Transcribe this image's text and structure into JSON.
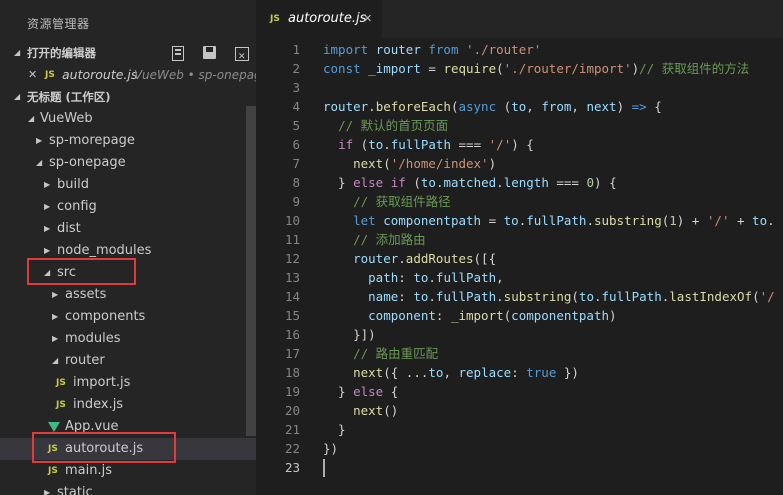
{
  "explorer": {
    "title": "资源管理器",
    "open_editors": {
      "label": "打开的编辑器",
      "file": {
        "badge": "JS",
        "name": "autoroute.js",
        "desc": "VueWeb • sp-onepag..."
      }
    },
    "workspace": {
      "label": "无标题 (工作区)"
    },
    "tree": [
      {
        "label": "VueWeb",
        "depth": 1,
        "twist": "open"
      },
      {
        "label": "sp-morepage",
        "depth": 2,
        "twist": "closed"
      },
      {
        "label": "sp-onepage",
        "depth": 2,
        "twist": "open"
      },
      {
        "label": "build",
        "depth": 3,
        "twist": "closed"
      },
      {
        "label": "config",
        "depth": 3,
        "twist": "closed"
      },
      {
        "label": "dist",
        "depth": 3,
        "twist": "closed"
      },
      {
        "label": "node_modules",
        "depth": 3,
        "twist": "closed"
      },
      {
        "label": "src",
        "depth": 3,
        "twist": "open"
      },
      {
        "label": "assets",
        "depth": 4,
        "twist": "closed"
      },
      {
        "label": "components",
        "depth": 4,
        "twist": "closed"
      },
      {
        "label": "modules",
        "depth": 4,
        "twist": "closed"
      },
      {
        "label": "router",
        "depth": 4,
        "twist": "open"
      },
      {
        "label": "import.js",
        "depth": 5,
        "icon": "JS"
      },
      {
        "label": "index.js",
        "depth": 5,
        "icon": "JS"
      },
      {
        "label": "App.vue",
        "depth": 4,
        "icon": "vue"
      },
      {
        "label": "autoroute.js",
        "depth": 4,
        "icon": "JS",
        "selected": true
      },
      {
        "label": "main.js",
        "depth": 4,
        "icon": "JS"
      },
      {
        "label": "static",
        "depth": 3,
        "twist": "closed"
      }
    ]
  },
  "tab": {
    "badge": "JS",
    "name": "autoroute.js",
    "close": "✕"
  },
  "editor": {
    "current_line": 23,
    "lines": [
      [
        [
          "k",
          "import"
        ],
        [
          "p",
          " "
        ],
        [
          "v",
          "router"
        ],
        [
          "p",
          " "
        ],
        [
          "k",
          "from"
        ],
        [
          "p",
          " "
        ],
        [
          "s",
          "'./router'"
        ]
      ],
      [
        [
          "k",
          "const"
        ],
        [
          "p",
          " "
        ],
        [
          "v",
          "_import"
        ],
        [
          "p",
          " = "
        ],
        [
          "f",
          "require"
        ],
        [
          "p",
          "("
        ],
        [
          "s",
          "'./router/import'"
        ],
        [
          "p",
          ")"
        ],
        [
          "c",
          "// 获取组件的方法"
        ]
      ],
      [],
      [
        [
          "v",
          "router"
        ],
        [
          "p",
          "."
        ],
        [
          "f",
          "beforeEach"
        ],
        [
          "p",
          "("
        ],
        [
          "k",
          "async"
        ],
        [
          "p",
          " ("
        ],
        [
          "v",
          "to"
        ],
        [
          "p",
          ", "
        ],
        [
          "v",
          "from"
        ],
        [
          "p",
          ", "
        ],
        [
          "v",
          "next"
        ],
        [
          "p",
          ") "
        ],
        [
          "k",
          "=>"
        ],
        [
          "p",
          " {"
        ]
      ],
      [
        [
          "p",
          "  "
        ],
        [
          "c",
          "// 默认的首页页面"
        ]
      ],
      [
        [
          "p",
          "  "
        ],
        [
          "kc",
          "if"
        ],
        [
          "p",
          " ("
        ],
        [
          "v",
          "to"
        ],
        [
          "p",
          "."
        ],
        [
          "v",
          "fullPath"
        ],
        [
          "p",
          " === "
        ],
        [
          "s",
          "'/'"
        ],
        [
          "p",
          ") {"
        ]
      ],
      [
        [
          "p",
          "    "
        ],
        [
          "f",
          "next"
        ],
        [
          "p",
          "("
        ],
        [
          "s",
          "'/home/index'"
        ],
        [
          "p",
          ")"
        ]
      ],
      [
        [
          "p",
          "  } "
        ],
        [
          "kc",
          "else"
        ],
        [
          "p",
          " "
        ],
        [
          "kc",
          "if"
        ],
        [
          "p",
          " ("
        ],
        [
          "v",
          "to"
        ],
        [
          "p",
          "."
        ],
        [
          "v",
          "matched"
        ],
        [
          "p",
          "."
        ],
        [
          "v",
          "length"
        ],
        [
          "p",
          " === "
        ],
        [
          "n",
          "0"
        ],
        [
          "p",
          ") {"
        ]
      ],
      [
        [
          "p",
          "    "
        ],
        [
          "c",
          "// 获取组件路径"
        ]
      ],
      [
        [
          "p",
          "    "
        ],
        [
          "k",
          "let"
        ],
        [
          "p",
          " "
        ],
        [
          "v",
          "componentpath"
        ],
        [
          "p",
          " = "
        ],
        [
          "v",
          "to"
        ],
        [
          "p",
          "."
        ],
        [
          "v",
          "fullPath"
        ],
        [
          "p",
          "."
        ],
        [
          "f",
          "substring"
        ],
        [
          "p",
          "("
        ],
        [
          "n",
          "1"
        ],
        [
          "p",
          ") + "
        ],
        [
          "s",
          "'/'"
        ],
        [
          "p",
          " + "
        ],
        [
          "v",
          "to"
        ],
        [
          "p",
          "."
        ]
      ],
      [
        [
          "p",
          "    "
        ],
        [
          "c",
          "// 添加路由"
        ]
      ],
      [
        [
          "p",
          "    "
        ],
        [
          "v",
          "router"
        ],
        [
          "p",
          "."
        ],
        [
          "f",
          "addRoutes"
        ],
        [
          "p",
          "([{"
        ]
      ],
      [
        [
          "p",
          "      "
        ],
        [
          "v",
          "path"
        ],
        [
          "p",
          ": "
        ],
        [
          "v",
          "to"
        ],
        [
          "p",
          "."
        ],
        [
          "v",
          "fullPath"
        ],
        [
          "p",
          ","
        ]
      ],
      [
        [
          "p",
          "      "
        ],
        [
          "v",
          "name"
        ],
        [
          "p",
          ": "
        ],
        [
          "v",
          "to"
        ],
        [
          "p",
          "."
        ],
        [
          "v",
          "fullPath"
        ],
        [
          "p",
          "."
        ],
        [
          "f",
          "substring"
        ],
        [
          "p",
          "("
        ],
        [
          "v",
          "to"
        ],
        [
          "p",
          "."
        ],
        [
          "v",
          "fullPath"
        ],
        [
          "p",
          "."
        ],
        [
          "f",
          "lastIndexOf"
        ],
        [
          "p",
          "("
        ],
        [
          "s",
          "'/"
        ]
      ],
      [
        [
          "p",
          "      "
        ],
        [
          "v",
          "component"
        ],
        [
          "p",
          ": "
        ],
        [
          "f",
          "_import"
        ],
        [
          "p",
          "("
        ],
        [
          "v",
          "componentpath"
        ],
        [
          "p",
          ")"
        ]
      ],
      [
        [
          "p",
          "    }])"
        ]
      ],
      [
        [
          "p",
          "    "
        ],
        [
          "c",
          "// 路由重匹配"
        ]
      ],
      [
        [
          "p",
          "    "
        ],
        [
          "f",
          "next"
        ],
        [
          "p",
          "({ ..."
        ],
        [
          "v",
          "to"
        ],
        [
          "p",
          ", "
        ],
        [
          "v",
          "replace"
        ],
        [
          "p",
          ": "
        ],
        [
          "k",
          "true"
        ],
        [
          "p",
          " })"
        ]
      ],
      [
        [
          "p",
          "  } "
        ],
        [
          "kc",
          "else"
        ],
        [
          "p",
          " {"
        ]
      ],
      [
        [
          "p",
          "    "
        ],
        [
          "f",
          "next"
        ],
        [
          "p",
          "()"
        ]
      ],
      [
        [
          "p",
          "  }"
        ]
      ],
      [
        [
          "p",
          "})"
        ]
      ],
      []
    ]
  },
  "colors": {
    "red_highlight": "#e03a3a",
    "js_badge": "#cbcb41",
    "vue_badge": "#41b883"
  }
}
